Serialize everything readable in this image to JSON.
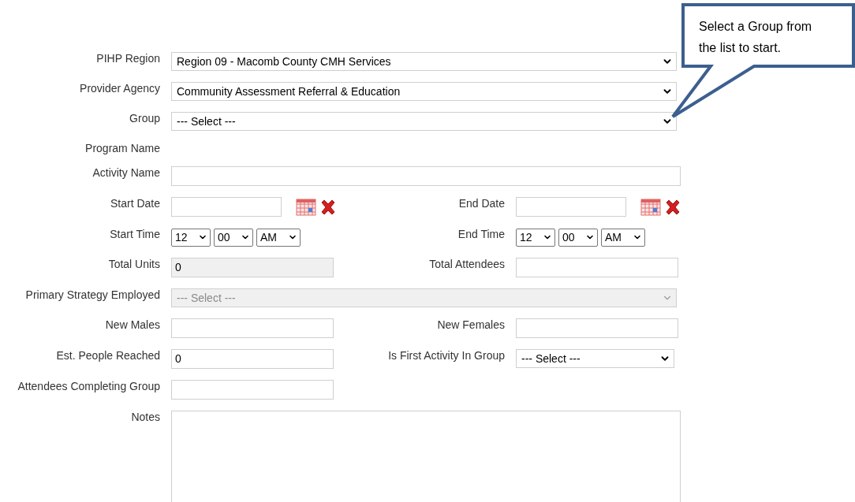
{
  "rows": [
    {
      "fields": [
        {
          "label": "PIHP Region",
          "kind": "wide-select",
          "value": "Region 09 - Macomb County CMH Services",
          "disabled": false
        }
      ]
    },
    {
      "fields": [
        {
          "label": "Provider Agency",
          "kind": "wide-select",
          "value": "Community Assessment Referral & Education",
          "disabled": false
        }
      ]
    },
    {
      "fields": [
        {
          "label": "Group",
          "kind": "wide-select",
          "value": "--- Select ---",
          "disabled": false
        }
      ]
    },
    {
      "fields": [
        {
          "label": "Program Name",
          "kind": "none"
        }
      ]
    },
    {
      "fields": [
        {
          "label": "Activity Name",
          "kind": "wide-text",
          "disabled": false
        }
      ]
    },
    {
      "fields": [
        {
          "label": "Start Date",
          "kind": "date"
        },
        {
          "label": "End Date",
          "kind": "date"
        }
      ]
    },
    {
      "fields": [
        {
          "label": "Start Time",
          "kind": "time",
          "hour": "12",
          "minute": "00",
          "meridiem": "AM"
        },
        {
          "label": "End Time",
          "kind": "time",
          "hour": "12",
          "minute": "00",
          "meridiem": "AM"
        }
      ]
    },
    {
      "fields": [
        {
          "label": "Total Units",
          "kind": "text",
          "value": "0",
          "disabled": true
        },
        {
          "label": "Total Attendees",
          "kind": "text",
          "disabled": false
        }
      ]
    },
    {
      "fields": [
        {
          "label": "Primary Strategy Employed",
          "kind": "wide-select",
          "value": "--- Select ---",
          "disabled": true
        }
      ]
    },
    {
      "fields": [
        {
          "label": "New Males",
          "kind": "text",
          "disabled": false
        },
        {
          "label": "New Females",
          "kind": "text",
          "disabled": false
        }
      ]
    },
    {
      "fields": [
        {
          "label": "Est. People Reached",
          "kind": "text",
          "value": "0",
          "disabled": false
        },
        {
          "label": "Is First Activity In Group",
          "kind": "select",
          "value": "--- Select ---",
          "disabled": false
        }
      ]
    },
    {
      "fields": [
        {
          "label": "Attendees Completing Group",
          "kind": "text",
          "disabled": false
        }
      ]
    },
    {
      "fields": [
        {
          "label": "Notes",
          "kind": "notes"
        }
      ]
    }
  ],
  "callout": {
    "text": "Select a Group from the list to start."
  }
}
